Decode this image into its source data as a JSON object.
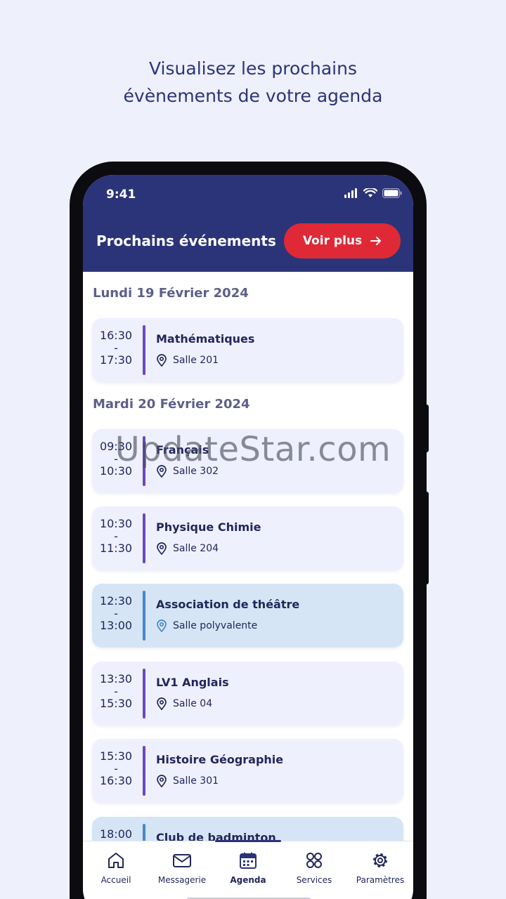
{
  "headline": {
    "line1": "Visualisez les prochains",
    "line2": "évènements de votre agenda"
  },
  "status": {
    "time": "9:41"
  },
  "appbar": {
    "title": "Prochains événements",
    "more_label": "Voir plus"
  },
  "days": [
    {
      "label": "Lundi 19 Février 2024"
    },
    {
      "label": "Mardi 20 Février 2024"
    }
  ],
  "events": [
    {
      "start": "16:30",
      "sep": "-",
      "end": "17:30",
      "subject": "Mathématiques",
      "room": "Salle 201"
    },
    {
      "start": "09:30",
      "sep": "-",
      "end": "10:30",
      "subject": "Français",
      "room": "Salle 302"
    },
    {
      "start": "10:30",
      "sep": "-",
      "end": "11:30",
      "subject": "Physique Chimie",
      "room": "Salle 204"
    },
    {
      "start": "12:30",
      "sep": "-",
      "end": "13:00",
      "subject": "Association de théâtre",
      "room": "Salle polyvalente"
    },
    {
      "start": "13:30",
      "sep": "-",
      "end": "15:30",
      "subject": "LV1 Anglais",
      "room": "Salle 04"
    },
    {
      "start": "15:30",
      "sep": "-",
      "end": "16:30",
      "subject": "Histoire Géographie",
      "room": "Salle 301"
    },
    {
      "start": "18:00",
      "subject": "Club de badminton"
    }
  ],
  "nav": [
    {
      "label": "Accueil",
      "icon": "home-icon"
    },
    {
      "label": "Messagerie",
      "icon": "mail-icon"
    },
    {
      "label": "Agenda",
      "icon": "calendar-icon",
      "active": true
    },
    {
      "label": "Services",
      "icon": "grid-icon"
    },
    {
      "label": "Paramètres",
      "icon": "gear-icon"
    }
  ],
  "watermark": "UpdateStar.com",
  "colors": {
    "brand": "#2b3478",
    "accent": "#e02936",
    "event_bar": "#6b48c2",
    "event_bar_alt": "#4a86c8"
  }
}
